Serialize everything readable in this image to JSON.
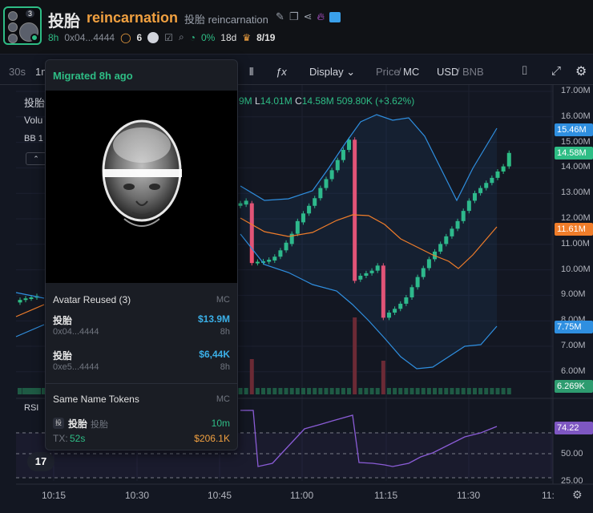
{
  "header": {
    "name": "投胎",
    "symbol": "reincarnation",
    "alt_name": "投胎",
    "alt_symbol": "reincarnation",
    "avatar_badge": "3",
    "age": "8h",
    "address": "0x04...4444",
    "holders": "6",
    "percent": "0%",
    "duration": "18d",
    "rank": "8/19"
  },
  "toolbar": {
    "interval_30s": "30s",
    "interval_1m": "1m",
    "display": "Display",
    "price": "Price",
    "mc": "MC",
    "usd": "USD",
    "bnb": "BNB",
    "slash": "/"
  },
  "chart_overlay": {
    "legend_name": "投胎",
    "ohlc_high_part": "9M",
    "ohlc_l": "L",
    "ohlc_l_val": "14.01M",
    "ohlc_c": "C",
    "ohlc_c_val": "14.58M",
    "ohlc_change": "509.80K (+3.62%)",
    "vol_label": "Volu",
    "bb_label": "BB 1",
    "rsi_label": "RSI"
  },
  "yaxis": {
    "labels": [
      "17.00M",
      "16.00M",
      "15.00M",
      "14.00M",
      "13.00M",
      "12.00M",
      "11.00M",
      "10.00M",
      "9.00M",
      "8.00M",
      "7.00M",
      "6.00M"
    ],
    "rsi_labels": [
      "50.00",
      "25.00"
    ],
    "tag_upper": "15.46M",
    "tag_price": "14.58M",
    "tag_mid": "11.61M",
    "tag_lower": "7.75M",
    "tag_vol": "6.269K",
    "tag_rsi": "74.22"
  },
  "xaxis": {
    "labels": [
      "10:15",
      "10:30",
      "10:45",
      "11:00",
      "11:15",
      "11:30",
      "11:"
    ]
  },
  "popover": {
    "title": "Migrated 8h ago",
    "avatar_reused": "Avatar Reused (3)",
    "mc_label": "MC",
    "items": [
      {
        "name": "投胎",
        "addr": "0x04...4444",
        "value": "$13.9M",
        "age": "8h"
      },
      {
        "name": "投胎",
        "addr": "0xe5...4444",
        "value": "$6,44K",
        "age": "8h"
      }
    ],
    "same_name": "Same Name Tokens",
    "same_item": {
      "name": "投胎",
      "alt": "投胎",
      "age": "10m",
      "tx_label": "TX:",
      "tx_val": "52s",
      "mc": "$206.1K"
    }
  },
  "colors": {
    "up": "#2ebd85",
    "down": "#f0506e",
    "bb": "#2f8fe0",
    "basis": "#f07d2a",
    "rsi": "#8a5cd6"
  },
  "chart_data": {
    "type": "candlestick",
    "ylim": [
      6000000,
      17000000
    ],
    "x_ticks": [
      "10:15",
      "10:30",
      "10:45",
      "11:00",
      "11:15",
      "11:30"
    ],
    "last_close": 14580000,
    "bb_upper_last": 15460000,
    "bb_basis_last": 11610000,
    "bb_lower_last": 7750000,
    "volume_last": 6269,
    "rsi_last": 74.22,
    "rsi_levels": [
      70,
      50,
      30
    ],
    "candles": [
      {
        "o": 8.7,
        "c": 8.8
      },
      {
        "o": 8.8,
        "c": 8.86
      },
      {
        "o": 8.86,
        "c": 8.9
      },
      {
        "o": 8.9,
        "c": 8.95
      },
      {
        "o": 12.5,
        "c": 12.6
      },
      {
        "o": 12.55,
        "c": 12.7
      },
      {
        "o": 12.6,
        "c": 10.25
      },
      {
        "o": 10.25,
        "c": 10.3
      },
      {
        "o": 10.28,
        "c": 10.32
      },
      {
        "o": 10.3,
        "c": 10.38
      },
      {
        "o": 10.35,
        "c": 10.5
      },
      {
        "o": 10.5,
        "c": 10.75
      },
      {
        "o": 10.75,
        "c": 11.05
      },
      {
        "o": 11.0,
        "c": 11.4
      },
      {
        "o": 11.4,
        "c": 11.9
      },
      {
        "o": 11.85,
        "c": 12.2
      },
      {
        "o": 12.2,
        "c": 12.5
      },
      {
        "o": 12.5,
        "c": 12.8
      },
      {
        "o": 12.8,
        "c": 13.2
      },
      {
        "o": 13.2,
        "c": 13.55
      },
      {
        "o": 13.55,
        "c": 13.9
      },
      {
        "o": 13.9,
        "c": 14.3
      },
      {
        "o": 14.3,
        "c": 14.7
      },
      {
        "o": 14.7,
        "c": 15.1
      },
      {
        "o": 15.1,
        "c": 9.55
      },
      {
        "o": 9.6,
        "c": 9.75
      },
      {
        "o": 9.75,
        "c": 9.85
      },
      {
        "o": 9.85,
        "c": 9.95
      },
      {
        "o": 9.95,
        "c": 10.15
      },
      {
        "o": 10.15,
        "c": 8.1
      },
      {
        "o": 8.1,
        "c": 8.3
      },
      {
        "o": 8.3,
        "c": 8.45
      },
      {
        "o": 8.45,
        "c": 8.65
      },
      {
        "o": 8.65,
        "c": 8.9
      },
      {
        "o": 8.9,
        "c": 9.3
      },
      {
        "o": 9.3,
        "c": 9.7
      },
      {
        "o": 9.7,
        "c": 10.05
      },
      {
        "o": 10.05,
        "c": 10.4
      },
      {
        "o": 10.4,
        "c": 10.7
      },
      {
        "o": 10.7,
        "c": 11.0
      },
      {
        "o": 11.0,
        "c": 11.3
      },
      {
        "o": 11.3,
        "c": 11.6
      },
      {
        "o": 11.6,
        "c": 11.9
      },
      {
        "o": 11.9,
        "c": 12.3
      },
      {
        "o": 12.3,
        "c": 12.7
      },
      {
        "o": 12.7,
        "c": 13.0
      },
      {
        "o": 13.0,
        "c": 13.2
      },
      {
        "o": 13.2,
        "c": 13.4
      },
      {
        "o": 13.4,
        "c": 13.6
      },
      {
        "o": 13.6,
        "c": 13.85
      },
      {
        "o": 13.85,
        "c": 14.05
      },
      {
        "o": 14.05,
        "c": 14.58
      }
    ]
  }
}
